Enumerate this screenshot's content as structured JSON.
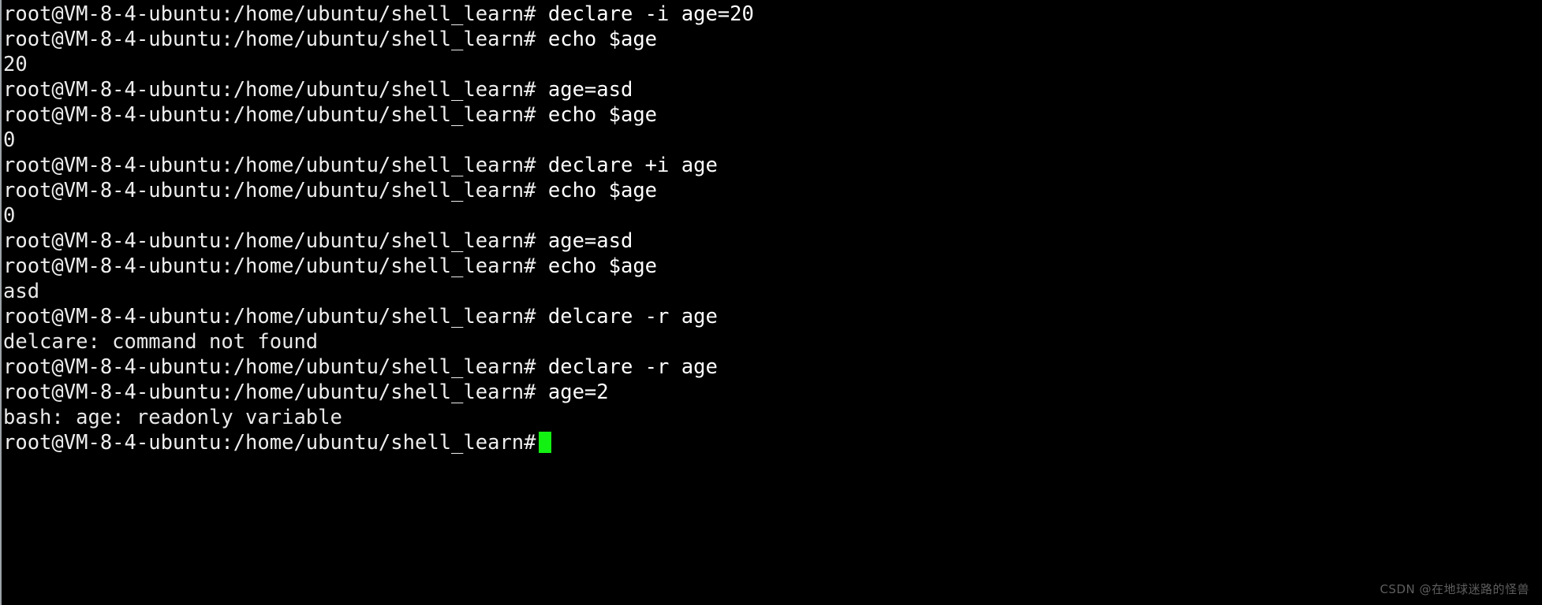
{
  "terminal": {
    "shell": "bash",
    "user": "root",
    "host": "VM-8-4-ubuntu",
    "cwd": "/home/ubuntu/shell_learn",
    "prompt": "root@VM-8-4-ubuntu:/home/ubuntu/shell_learn#",
    "background_color": "#000000",
    "text_color": "#e8e8e8",
    "cursor_color": "#13f113",
    "cursor_glyph": "block-cursor",
    "lines": [
      {
        "type": "command",
        "prompt": "root@VM-8-4-ubuntu:/home/ubuntu/shell_learn#",
        "command": " declare -i age=20"
      },
      {
        "type": "command",
        "prompt": "root@VM-8-4-ubuntu:/home/ubuntu/shell_learn#",
        "command": " echo $age"
      },
      {
        "type": "output",
        "text": "20"
      },
      {
        "type": "command",
        "prompt": "root@VM-8-4-ubuntu:/home/ubuntu/shell_learn#",
        "command": " age=asd"
      },
      {
        "type": "command",
        "prompt": "root@VM-8-4-ubuntu:/home/ubuntu/shell_learn#",
        "command": " echo $age"
      },
      {
        "type": "output",
        "text": "0"
      },
      {
        "type": "command",
        "prompt": "root@VM-8-4-ubuntu:/home/ubuntu/shell_learn#",
        "command": " declare +i age"
      },
      {
        "type": "command",
        "prompt": "root@VM-8-4-ubuntu:/home/ubuntu/shell_learn#",
        "command": " echo $age"
      },
      {
        "type": "output",
        "text": "0"
      },
      {
        "type": "command",
        "prompt": "root@VM-8-4-ubuntu:/home/ubuntu/shell_learn#",
        "command": " age=asd"
      },
      {
        "type": "command",
        "prompt": "root@VM-8-4-ubuntu:/home/ubuntu/shell_learn#",
        "command": " echo $age"
      },
      {
        "type": "output",
        "text": "asd"
      },
      {
        "type": "command",
        "prompt": "root@VM-8-4-ubuntu:/home/ubuntu/shell_learn#",
        "command": " delcare -r age"
      },
      {
        "type": "output",
        "text": "delcare: command not found"
      },
      {
        "type": "command",
        "prompt": "root@VM-8-4-ubuntu:/home/ubuntu/shell_learn#",
        "command": " declare -r age"
      },
      {
        "type": "command",
        "prompt": "root@VM-8-4-ubuntu:/home/ubuntu/shell_learn#",
        "command": " age=2"
      },
      {
        "type": "output",
        "text": "bash: age: readonly variable"
      },
      {
        "type": "prompt",
        "prompt": "root@VM-8-4-ubuntu:/home/ubuntu/shell_learn#",
        "command": "",
        "cursor": true
      }
    ]
  },
  "watermark": {
    "text": "CSDN @在地球迷路的怪兽"
  }
}
